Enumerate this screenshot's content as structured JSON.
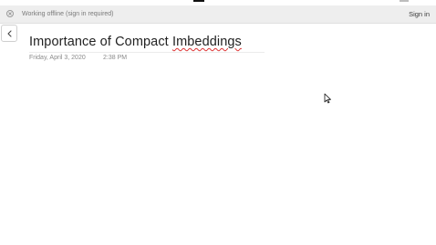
{
  "banner": {
    "status_text": "Working offline (sign in required)",
    "sign_in_label": "Sign in",
    "status_icon": "offline-icon"
  },
  "nav": {
    "back_icon": "chevron-left-icon"
  },
  "page": {
    "title_prefix": "Importance of Compact ",
    "title_misspelled_word": "Imbeddings",
    "date": "Friday, April 3, 2020",
    "time": "2:38 PM"
  },
  "colors": {
    "banner_bg": "#eeeeee",
    "spellcheck_underline": "#dd3333"
  }
}
